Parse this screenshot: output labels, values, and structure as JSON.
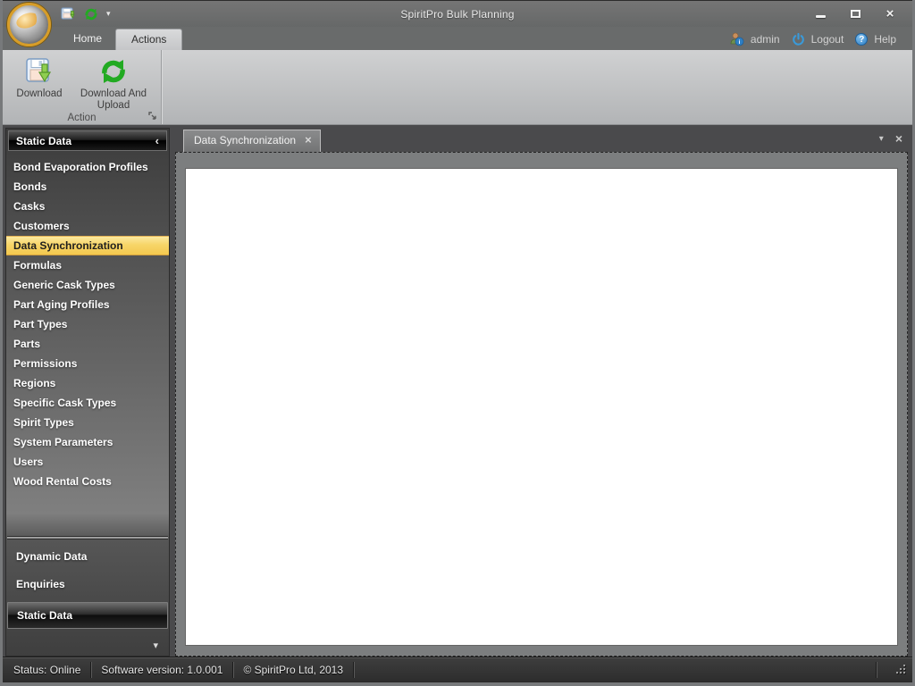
{
  "titlebar": {
    "title": "SpiritPro Bulk Planning"
  },
  "ribbon": {
    "tabs": [
      {
        "label": "Home"
      },
      {
        "label": "Actions"
      }
    ],
    "active_tab": "Actions",
    "session": {
      "user": "admin",
      "logout_label": "Logout",
      "help_label": "Help",
      "help_glyph": "?"
    },
    "group": {
      "label": "Action",
      "buttons": [
        {
          "label": "Download"
        },
        {
          "label": "Download And Upload"
        }
      ]
    }
  },
  "icons": {
    "qat_dropdown_caret": "▾",
    "sidebar_collapse_chevron": "‹",
    "sidebar_group_caret": "▾",
    "doc_tab_close": "×",
    "doc_list_caret": "▾",
    "doc_close": "×"
  },
  "sidebar": {
    "header": "Static Data",
    "active_item": "Data Synchronization",
    "items": [
      {
        "label": "Bond Evaporation Profiles"
      },
      {
        "label": "Bonds"
      },
      {
        "label": "Casks"
      },
      {
        "label": "Customers"
      },
      {
        "label": "Data Synchronization"
      },
      {
        "label": "Formulas"
      },
      {
        "label": "Generic Cask Types"
      },
      {
        "label": "Part Aging Profiles"
      },
      {
        "label": "Part Types"
      },
      {
        "label": "Parts"
      },
      {
        "label": "Permissions"
      },
      {
        "label": "Regions"
      },
      {
        "label": "Specific Cask Types"
      },
      {
        "label": "Spirit Types"
      },
      {
        "label": "System Parameters"
      },
      {
        "label": "Users"
      },
      {
        "label": "Wood Rental Costs"
      }
    ],
    "active_group": "Static Data",
    "groups": [
      {
        "label": "Dynamic Data"
      },
      {
        "label": "Enquiries"
      },
      {
        "label": "Static Data"
      }
    ]
  },
  "document": {
    "tab_label": "Data Synchronization"
  },
  "statusbar": {
    "segments": [
      {
        "text": "Status: Online"
      },
      {
        "text": "Software version: 1.0.001"
      },
      {
        "text": "© SpiritPro Ltd, 2013"
      }
    ]
  },
  "colors": {
    "selection_yellow": "#F7D568",
    "accent_blue": "#3A9AD9",
    "sync_green": "#2DB52D",
    "ribbon_face": "#C5C6C8"
  }
}
